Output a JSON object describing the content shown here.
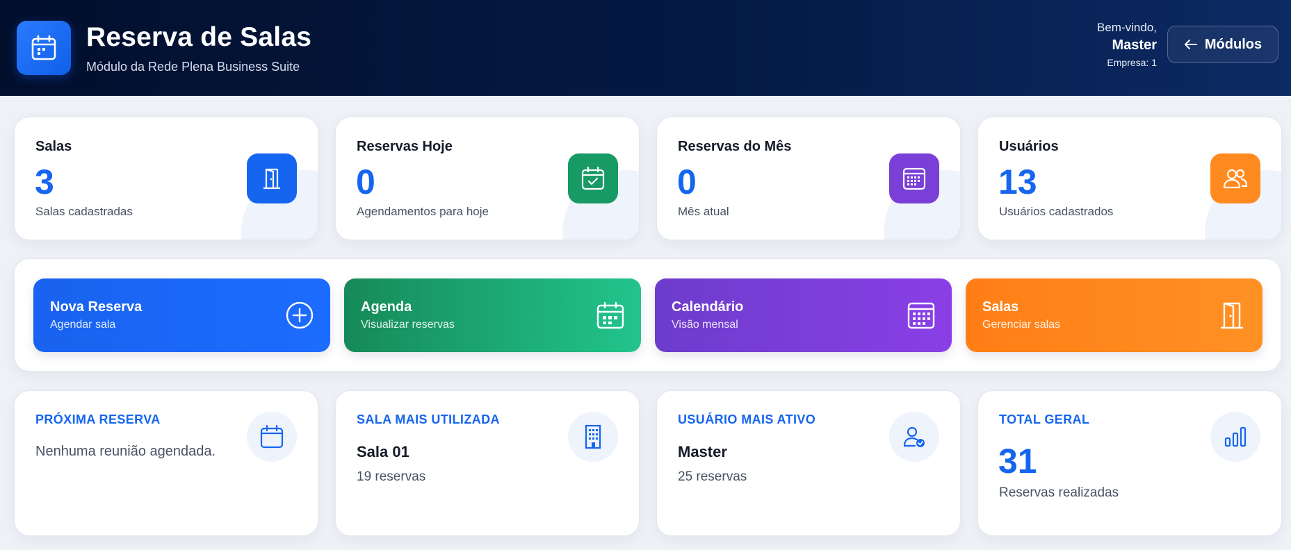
{
  "header": {
    "title": "Reserva de Salas",
    "subtitle": "Módulo da Rede Plena Business Suite",
    "logo_icon": "calendar-icon",
    "welcome": "Bem-vindo,",
    "user_name": "Master",
    "company": "Empresa: 1",
    "modules_label": "Módulos"
  },
  "stats": [
    {
      "label": "Salas",
      "value": "3",
      "desc": "Salas cadastradas",
      "icon": "door-icon",
      "color": "#1565f0"
    },
    {
      "label": "Reservas Hoje",
      "value": "0",
      "desc": "Agendamentos para hoje",
      "icon": "calendar-check-icon",
      "color": "#179a63"
    },
    {
      "label": "Reservas do Mês",
      "value": "0",
      "desc": "Mês atual",
      "icon": "calendar-grid-icon",
      "color": "#7a3fd6"
    },
    {
      "label": "Usuários",
      "value": "13",
      "desc": "Usuários cadastrados",
      "icon": "users-icon",
      "color": "#ff8a1f"
    }
  ],
  "actions": [
    {
      "title": "Nova Reserva",
      "sub": "Agendar sala",
      "icon": "plus-circle-icon",
      "color": "#1565f0"
    },
    {
      "title": "Agenda",
      "sub": "Visualizar reservas",
      "icon": "calendar-icon",
      "color": "#179a63"
    },
    {
      "title": "Calendário",
      "sub": "Visão mensal",
      "icon": "calendar-grid-icon",
      "color": "#7a3fd6"
    },
    {
      "title": "Salas",
      "sub": "Gerenciar salas",
      "icon": "door-icon",
      "color": "#ff8a1f"
    }
  ],
  "info": {
    "next": {
      "label": "PRÓXIMA RESERVA",
      "text": "Nenhuma reunião agendada.",
      "icon": "calendar-icon"
    },
    "room": {
      "label": "SALA MAIS UTILIZADA",
      "main": "Sala 01",
      "sub": "19 reservas",
      "icon": "building-icon"
    },
    "user": {
      "label": "USUÁRIO MAIS ATIVO",
      "main": "Master",
      "sub": "25 reservas",
      "icon": "user-check-icon"
    },
    "total": {
      "label": "TOTAL GERAL",
      "value": "31",
      "sub": "Reservas realizadas",
      "icon": "bar-chart-icon"
    }
  },
  "colors": {
    "accent": "#1565f0",
    "header_bg": "#020f2d"
  }
}
